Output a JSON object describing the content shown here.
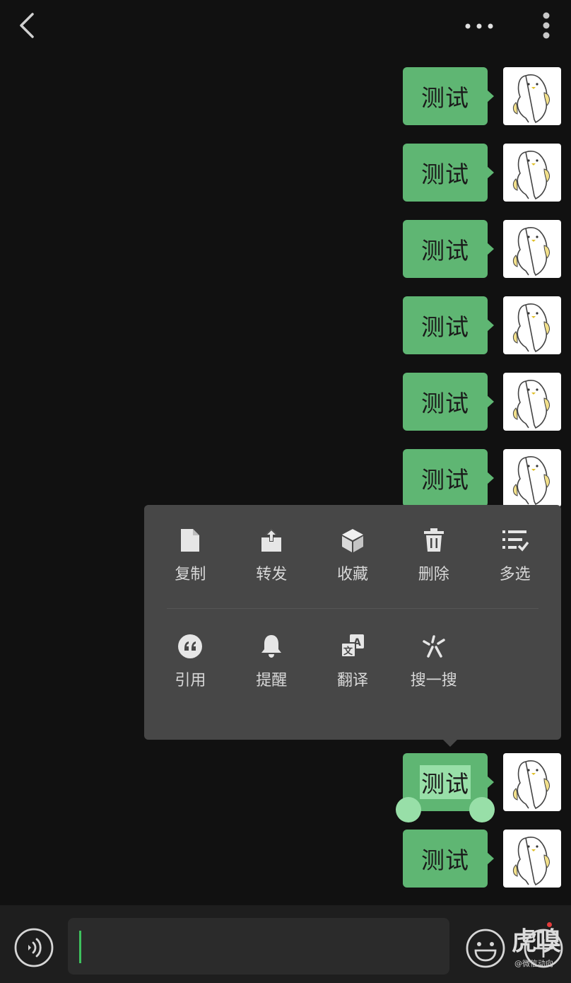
{
  "header": {
    "back_icon": "chevron-left-icon",
    "more_icon": "more-horizontal-icon",
    "overflow_icon": "more-vertical-icon"
  },
  "messages": [
    {
      "text": "测试",
      "selected": false
    },
    {
      "text": "测试",
      "selected": false
    },
    {
      "text": "测试",
      "selected": false
    },
    {
      "text": "测试",
      "selected": false
    },
    {
      "text": "测试",
      "selected": false
    },
    {
      "text": "测试",
      "selected": false
    },
    {
      "text": "测试",
      "selected": true
    },
    {
      "text": "测试",
      "selected": false
    }
  ],
  "context_menu": {
    "row1": [
      {
        "label": "复制",
        "icon": "document-icon"
      },
      {
        "label": "转发",
        "icon": "share-icon"
      },
      {
        "label": "收藏",
        "icon": "cube-icon"
      },
      {
        "label": "删除",
        "icon": "trash-icon"
      },
      {
        "label": "多选",
        "icon": "checklist-icon"
      }
    ],
    "row2": [
      {
        "label": "引用",
        "icon": "quote-icon"
      },
      {
        "label": "提醒",
        "icon": "bell-icon"
      },
      {
        "label": "翻译",
        "icon": "translate-icon"
      },
      {
        "label": "搜一搜",
        "icon": "sparkle-search-icon"
      }
    ]
  },
  "input_bar": {
    "voice_icon": "voice-icon",
    "emoji_icon": "emoji-icon",
    "plus_icon": "plus-icon"
  },
  "watermark": {
    "logo": "虎嗅",
    "text": "@微信动向"
  },
  "colors": {
    "background": "#111111",
    "bubble": "#5fb673",
    "selection": "#98dfa8",
    "menu": "#474747",
    "caret": "#3ec15e"
  }
}
